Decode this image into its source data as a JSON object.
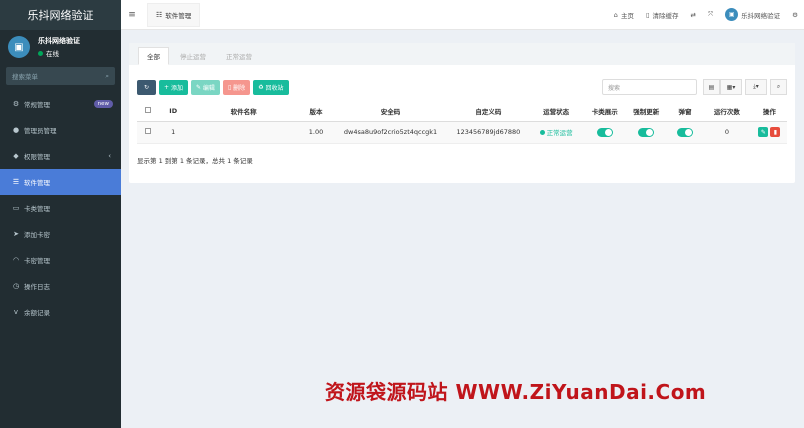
{
  "app": {
    "title": "乐抖网络验证"
  },
  "user": {
    "name": "乐抖网络验证",
    "status": "在线",
    "status_color": "#00a65a"
  },
  "sidebar": {
    "search_placeholder": "搜索菜单",
    "items": [
      {
        "label": "常规管理",
        "icon": "gears-icon",
        "badge": "new"
      },
      {
        "label": "管理员管理",
        "icon": "user-icon"
      },
      {
        "label": "权限管理",
        "icon": "users-icon",
        "has_children": true
      },
      {
        "label": "软件管理",
        "icon": "list-icon",
        "active": true
      },
      {
        "label": "卡类管理",
        "icon": "card-icon"
      },
      {
        "label": "添加卡密",
        "icon": "send-icon"
      },
      {
        "label": "卡密管理",
        "icon": "rss-icon"
      },
      {
        "label": "操作日志",
        "icon": "clock-icon"
      },
      {
        "label": "余额记录",
        "icon": "vimeo-icon"
      }
    ]
  },
  "header": {
    "tab_label": "软件管理",
    "home_label": "主页",
    "clear_cache_label": "清除缓存",
    "user_label": "乐抖网络验证"
  },
  "panel": {
    "tabs": [
      {
        "label": "全部",
        "active": true
      },
      {
        "label": "停止运营"
      },
      {
        "label": "正常运营"
      }
    ],
    "toolbar": {
      "add_label": "添加",
      "edit_label": "编辑",
      "delete_label": "删除",
      "recycle_label": "回收站",
      "search_placeholder": "搜索"
    },
    "table": {
      "headers": [
        "",
        "ID",
        "软件名称",
        "版本",
        "安全码",
        "自定义码",
        "运营状态",
        "卡类展示",
        "强制更新",
        "弹窗",
        "运行次数",
        "操作"
      ],
      "rows": [
        {
          "id": "1",
          "name": "",
          "version": "1.00",
          "security_code": "dw4sa8u9of2crio5zt4qccgk1",
          "custom_code": "123456789jd67880",
          "status": "正常运营",
          "card_display": true,
          "force_update": true,
          "popup": true,
          "run_count": "0"
        }
      ]
    },
    "page_info": "显示第 1 到第 1 条记录，总共 1 条记录"
  },
  "watermark": "资源袋源码站 WWW.ZiYuanDai.Com",
  "colors": {
    "sidebar_bg": "#222d32",
    "active_item": "#4a7cd8",
    "accent": "#18bc9c",
    "danger": "#e74c3c"
  }
}
